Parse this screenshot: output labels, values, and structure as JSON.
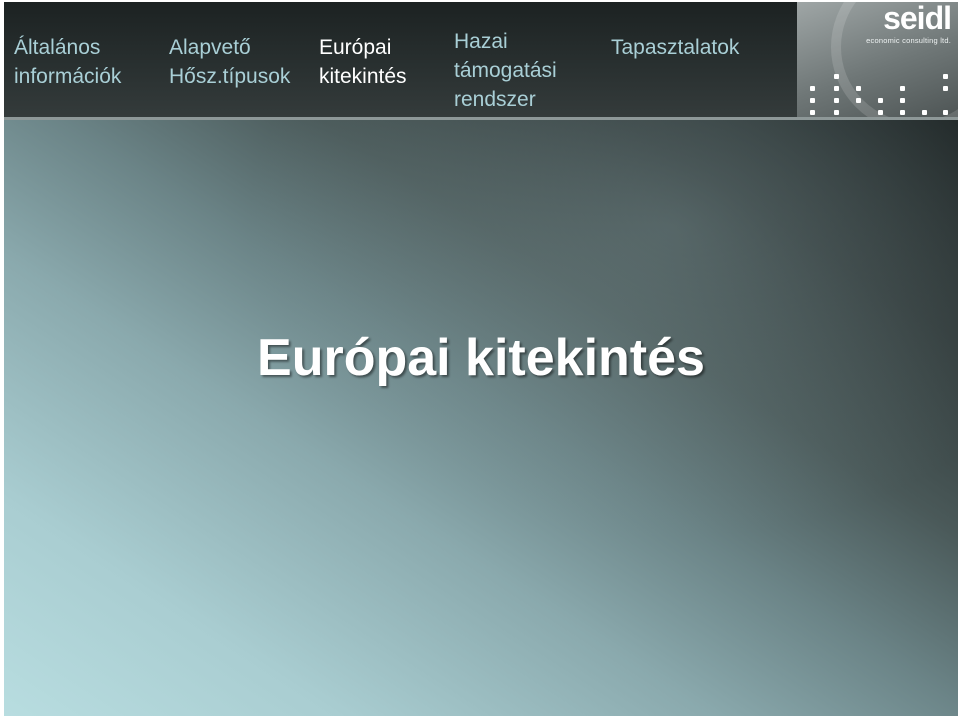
{
  "nav": {
    "items": [
      {
        "lines": [
          "Általános",
          "információk"
        ],
        "active": false
      },
      {
        "lines": [
          "Alapvető",
          "Hősz.típusok"
        ],
        "active": false
      },
      {
        "lines": [
          "Európai",
          "kitekintés"
        ],
        "active": true
      },
      {
        "lines": [
          "Hazai",
          "támogatási",
          "rendszer"
        ],
        "active": false
      },
      {
        "lines": [
          "Tapasztalatok"
        ],
        "active": false
      }
    ]
  },
  "logo": {
    "name": "seidl",
    "tagline": "economic consulting ltd."
  },
  "slide": {
    "title": "Európai kitekintés"
  },
  "colors": {
    "nav_inactive": "#a9cfd6",
    "nav_active": "#ffffff",
    "nav_background": "#2a3131"
  }
}
